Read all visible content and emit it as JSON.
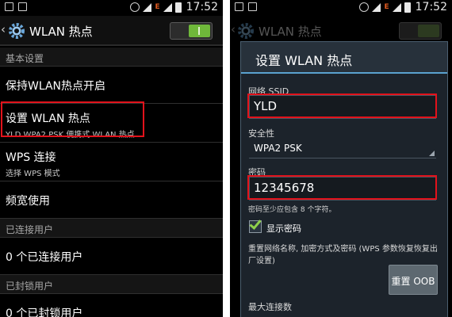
{
  "status_bar": {
    "time": "17:52",
    "network_label": "E"
  },
  "left": {
    "app_title": "WLAN 热点",
    "section_basic": "基本设置",
    "item_keep_on": "保持WLAN热点开启",
    "item_setup_title": "设置 WLAN 热点",
    "item_setup_subtitle": "YLD WPA2 PSK 便携式 WLAN 热点",
    "item_wps_title": "WPS 连接",
    "item_wps_subtitle": "选择 WPS 模式",
    "item_bandwidth": "频宽使用",
    "section_connected": "已连接用户",
    "item_connected_count": "0 个已连接用户",
    "section_blocked": "已封锁用户",
    "item_blocked_count": "0 个已封锁用户"
  },
  "right": {
    "bg_title": "WLAN 热点",
    "dialog_title": "设置 WLAN 热点",
    "ssid_label": "网络 SSID",
    "ssid_value": "YLD",
    "security_label": "安全性",
    "security_value": "WPA2 PSK",
    "password_label": "密码",
    "password_value": "12345678",
    "password_hint": "密码至少应包含 8 个字符。",
    "show_password_label": "显示密码",
    "show_password_checked": true,
    "reset_description": "重置网络名称, 加密方式及密码 (WPS 参数恢复恢复出厂设置)",
    "reset_button": "重置 OOB",
    "max_connections_label": "最大连接数"
  },
  "colors": {
    "highlight": "#e2121b",
    "toggle_on": "#6fb83a",
    "dialog_accent": "#5aa2cf"
  }
}
